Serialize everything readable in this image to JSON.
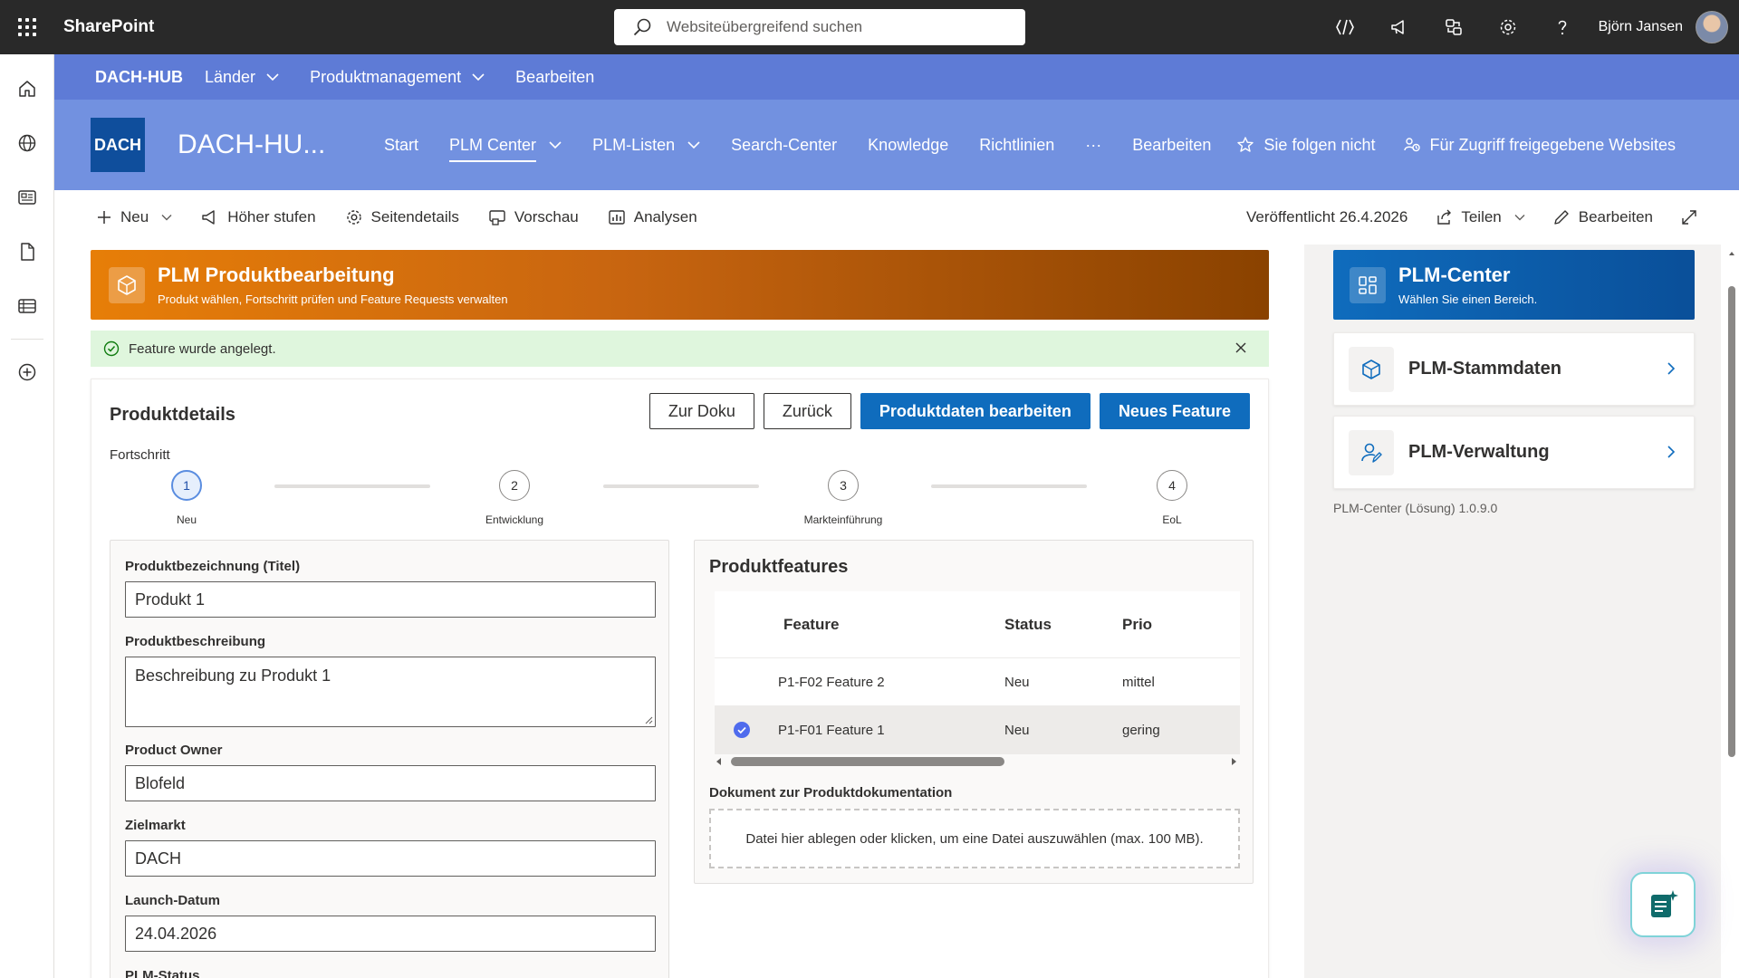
{
  "suite": {
    "app_name": "SharePoint",
    "search_placeholder": "Websiteübergreifend suchen",
    "user_name": "Björn Jansen",
    "icons": [
      "code-icon",
      "megaphone-icon",
      "connections-icon",
      "gear-icon",
      "help-icon"
    ]
  },
  "rail": {
    "icons": [
      "home-icon",
      "globe-icon",
      "news-icon",
      "document-icon",
      "list-icon",
      "add-circle-icon"
    ]
  },
  "hub": {
    "title": "DACH-HUB",
    "items": [
      {
        "label": "Länder",
        "has_dropdown": true
      },
      {
        "label": "Produktmanagement",
        "has_dropdown": true
      },
      {
        "label": "Bearbeiten",
        "has_dropdown": false
      }
    ]
  },
  "site": {
    "logo_text": "DACH",
    "title": "DACH-HU...",
    "nav": [
      {
        "label": "Start"
      },
      {
        "label": "PLM Center",
        "active": true
      },
      {
        "label": "PLM-Listen"
      },
      {
        "label": "Search-Center"
      },
      {
        "label": "Knowledge"
      },
      {
        "label": "Richtlinien"
      },
      {
        "label": "···"
      },
      {
        "label": "Bearbeiten"
      }
    ],
    "follow_label": "Sie folgen nicht",
    "shared_label": "Für Zugriff freigegebene Websites"
  },
  "commandbar": {
    "new_label": "Neu",
    "promote_label": "Höher stufen",
    "page_details_label": "Seitendetails",
    "preview_label": "Vorschau",
    "analytics_label": "Analysen",
    "published_label": "Veröffentlicht 26.4.2026",
    "share_label": "Teilen",
    "edit_label": "Bearbeiten"
  },
  "banner": {
    "title": "PLM Produktbearbeitung",
    "subtitle": "Produkt wählen, Fortschritt prüfen und Feature Requests verwalten"
  },
  "message": {
    "text": "Feature wurde angelegt."
  },
  "details": {
    "title": "Produktdetails",
    "buttons": {
      "doc": "Zur Doku",
      "back": "Zurück",
      "edit": "Produktdaten bearbeiten",
      "new_feature": "Neues Feature"
    },
    "progress_label": "Fortschritt",
    "steps": [
      {
        "number": "1",
        "label": "Neu",
        "active": true
      },
      {
        "number": "2",
        "label": "Entwicklung",
        "active": false
      },
      {
        "number": "3",
        "label": "Markteinführung",
        "active": false
      },
      {
        "number": "4",
        "label": "EoL",
        "active": false
      }
    ],
    "form": {
      "title_label": "Produktbezeichnung (Titel)",
      "title_value": "Produkt 1",
      "desc_label": "Produktbeschreibung",
      "desc_value": "Beschreibung zu Produkt 1",
      "owner_label": "Product Owner",
      "owner_value": "Blofeld",
      "market_label": "Zielmarkt",
      "market_value": "DACH",
      "launch_label": "Launch-Datum",
      "launch_value": "24.04.2026",
      "status_label": "PLM-Status"
    }
  },
  "features": {
    "title": "Produktfeatures",
    "columns": {
      "feature": "Feature",
      "status": "Status",
      "prio": "Prio"
    },
    "rows": [
      {
        "feature": "P1-F02 Feature 2",
        "status": "Neu",
        "prio": "mittel",
        "selected": false
      },
      {
        "feature": "P1-F01 Feature 1",
        "status": "Neu",
        "prio": "gering",
        "selected": true
      }
    ],
    "doc_label": "Dokument zur Produktdokumentation",
    "dropzone_text": "Datei hier ablegen oder klicken, um eine Datei auszuwählen (max. 100 MB)."
  },
  "sidebar": {
    "main_tile": {
      "title": "PLM-Center",
      "subtitle": "Wählen Sie einen Bereich."
    },
    "tiles": [
      {
        "label": "PLM-Stammdaten"
      },
      {
        "label": "PLM-Verwaltung"
      }
    ],
    "version": "PLM-Center (Lösung) 1.0.9.0"
  },
  "colors": {
    "suitebar": "#292929",
    "hubnav": "#5e7bd6",
    "siteheader": "#7291e0",
    "primary": "#0f6cbd",
    "banner_start": "#e77e08",
    "banner_end": "#8a4200",
    "success_bg": "#dff6dd"
  }
}
